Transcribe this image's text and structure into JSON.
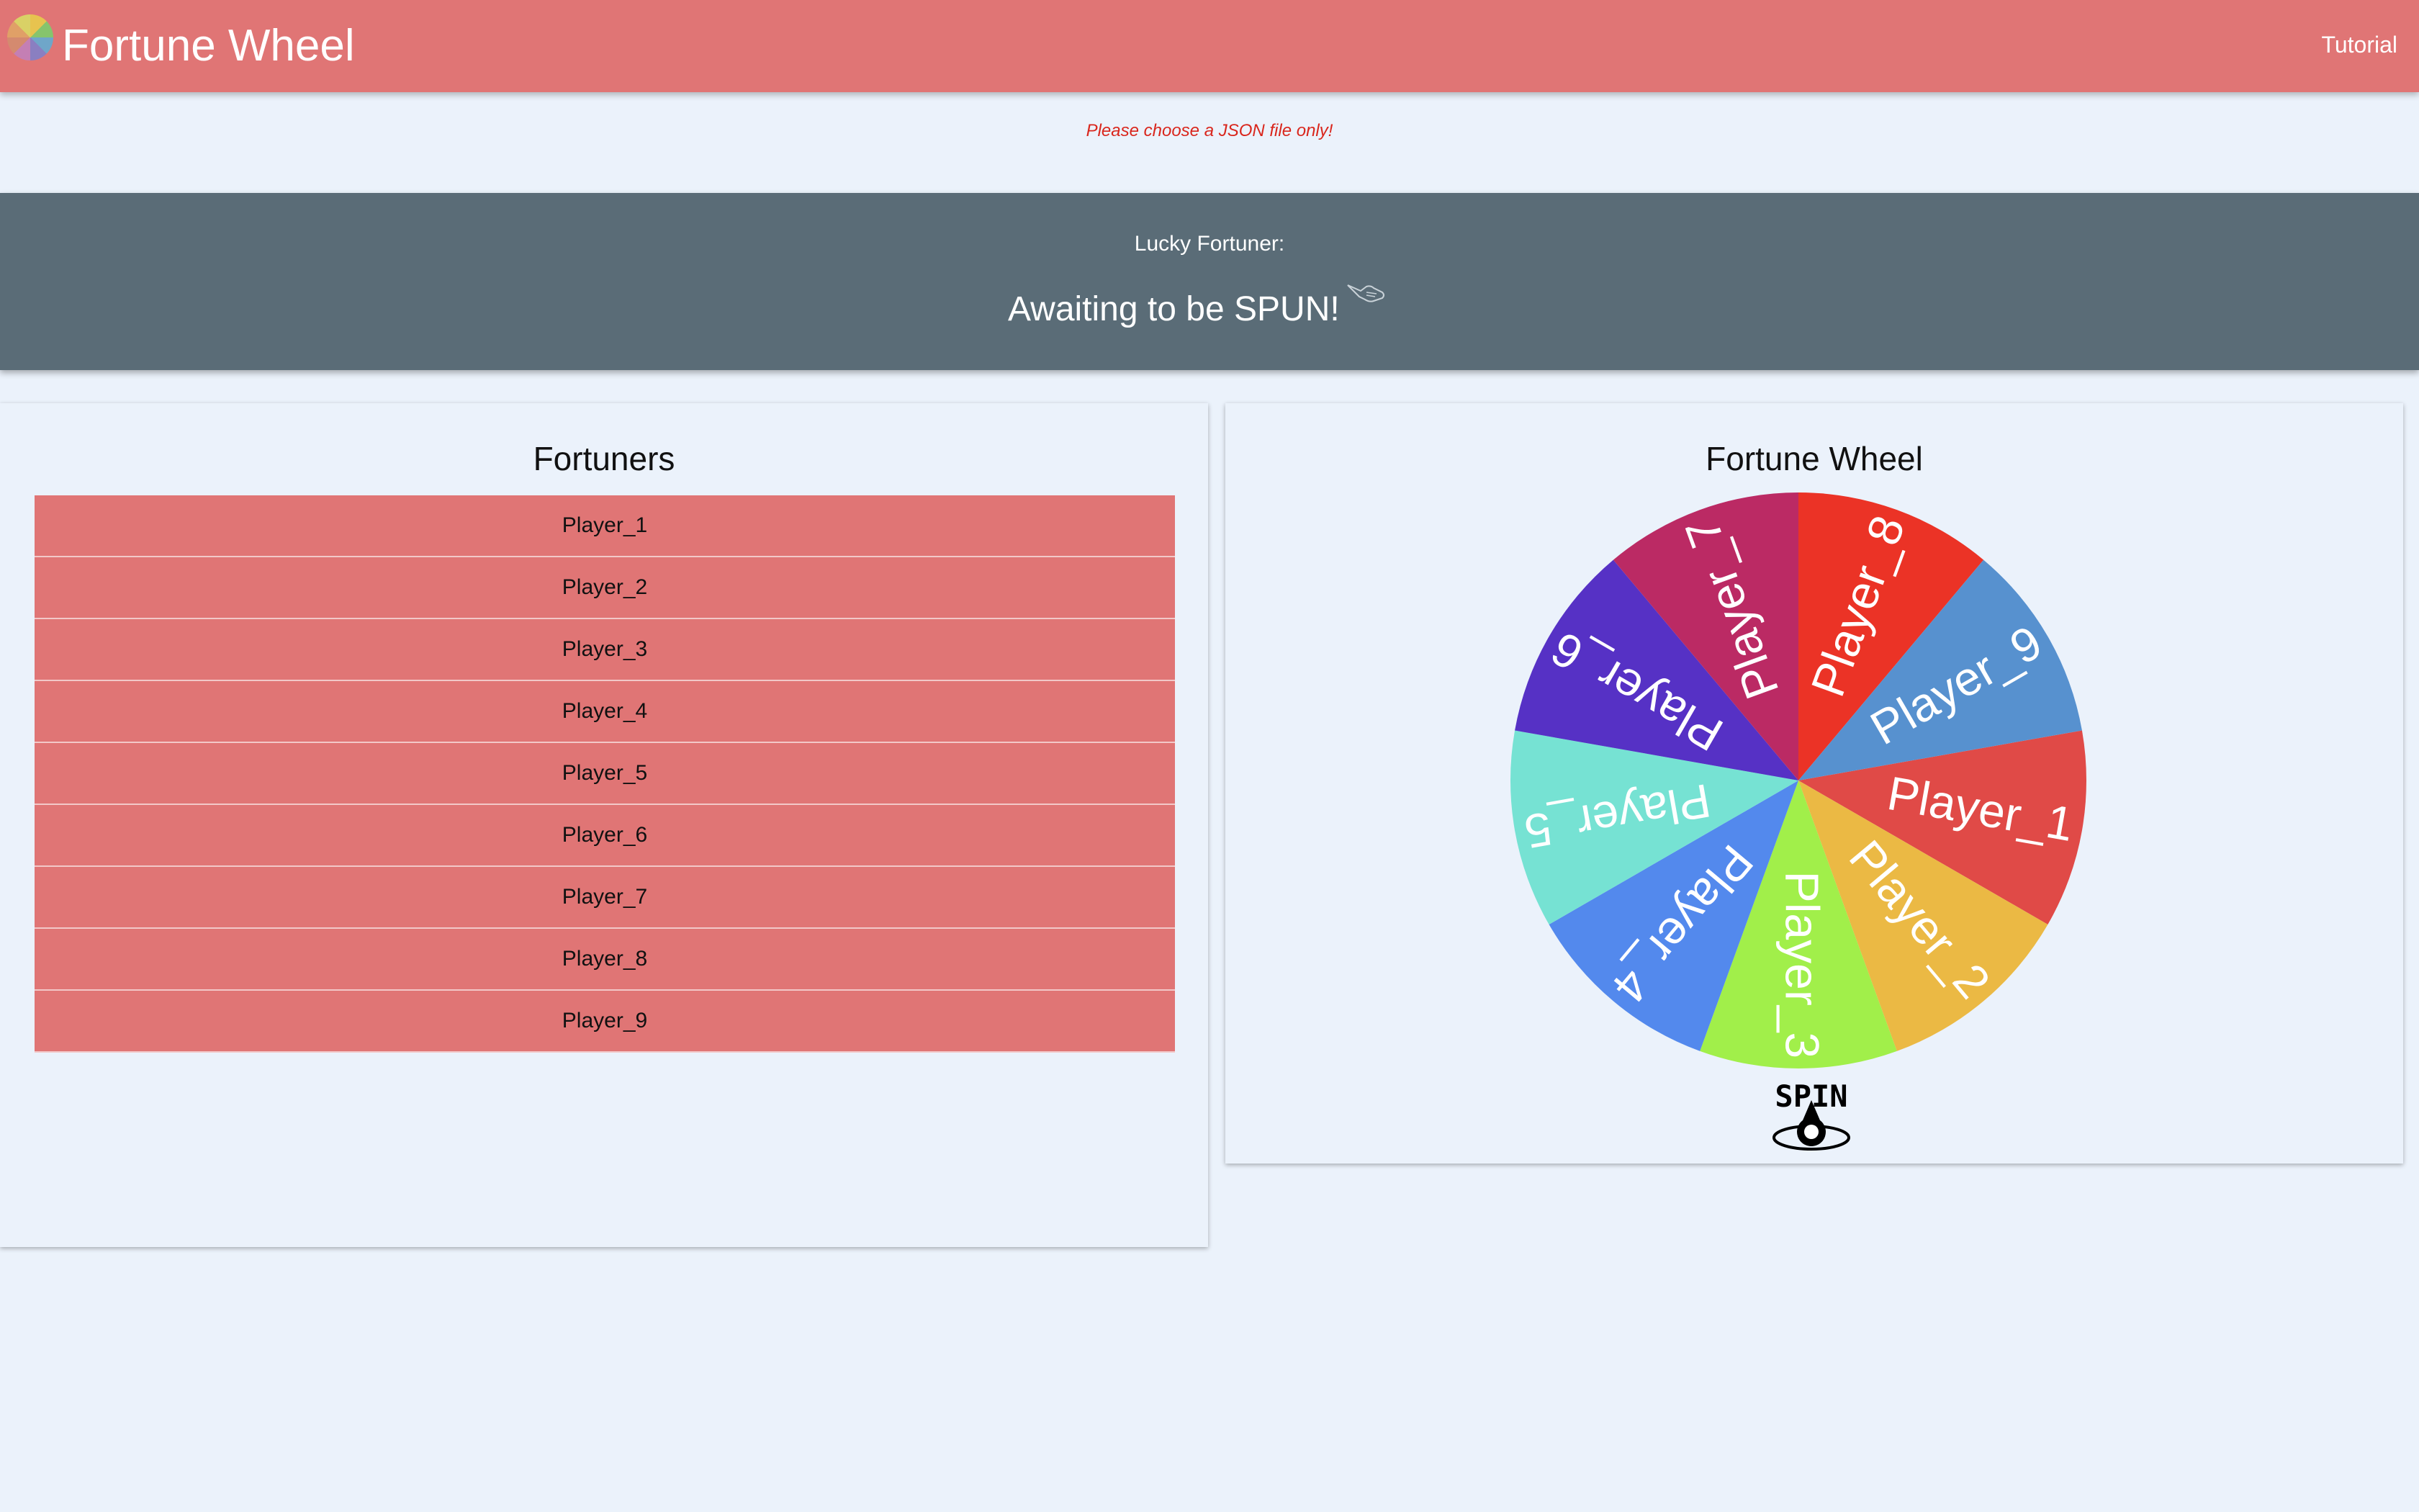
{
  "app": {
    "title": "Fortune Wheel",
    "nav_link": "Tutorial"
  },
  "warning": "Please choose a JSON file only!",
  "banner": {
    "label": "Lucky Fortuner:",
    "result": "Awaiting to be SPUN!"
  },
  "fortuners": {
    "title": "Fortuners",
    "players": [
      "Player_1",
      "Player_2",
      "Player_3",
      "Player_4",
      "Player_5",
      "Player_6",
      "Player_7",
      "Player_8",
      "Player_9"
    ]
  },
  "wheel": {
    "title": "Fortune Wheel",
    "spin_label": "SPIN",
    "segments": [
      {
        "label": "Player_1",
        "color": "#e04a47"
      },
      {
        "label": "Player_2",
        "color": "#ebb944"
      },
      {
        "label": "Player_3",
        "color": "#a1ef4a"
      },
      {
        "label": "Player_4",
        "color": "#5389ed"
      },
      {
        "label": "Player_5",
        "color": "#76e2d3"
      },
      {
        "label": "Player_6",
        "color": "#5631c5"
      },
      {
        "label": "Player_7",
        "color": "#bb2a64"
      },
      {
        "label": "Player_8",
        "color": "#eb3326"
      },
      {
        "label": "Player_9",
        "color": "#5791cf"
      }
    ]
  },
  "colors": {
    "navbar": "#e07575",
    "banner": "#5a6c77",
    "background": "#ebf2fb",
    "warning": "#d9261c"
  }
}
